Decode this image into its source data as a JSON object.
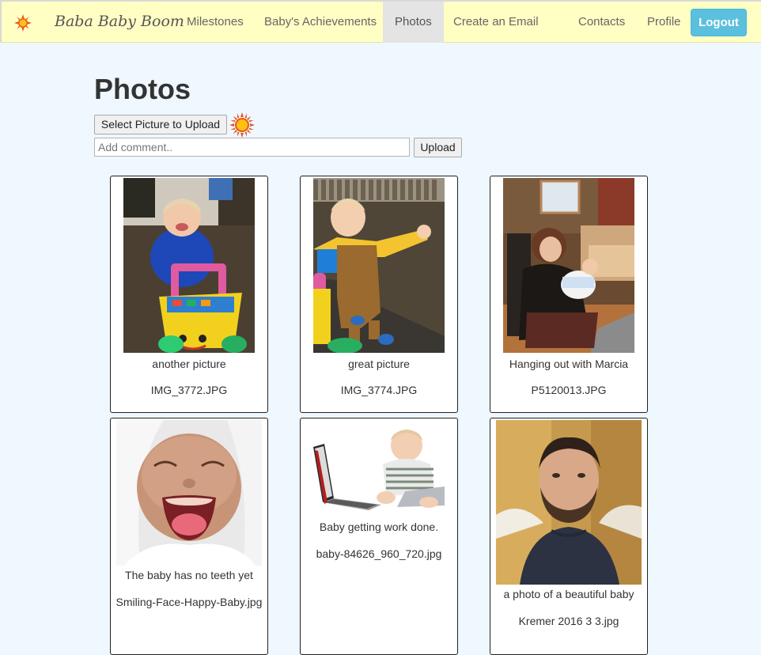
{
  "nav": {
    "brand": "Baba Baby Boom",
    "items": [
      {
        "label": "Milestones",
        "active": false
      },
      {
        "label": "Baby's Achievements",
        "active": false
      },
      {
        "label": "Photos",
        "active": true
      },
      {
        "label": "Create an Email",
        "active": false
      },
      {
        "label": "Contacts",
        "active": false
      },
      {
        "label": "Profile",
        "active": false
      }
    ],
    "logout": "Logout"
  },
  "page": {
    "title": "Photos",
    "select_button": "Select Picture to Upload",
    "comment_placeholder": "Add comment..",
    "upload_button": "Upload"
  },
  "photos": [
    {
      "caption": "another picture",
      "filename": "IMG_3772.JPG"
    },
    {
      "caption": "great picture",
      "filename": "IMG_3774.JPG"
    },
    {
      "caption": "Hanging out with Marcia",
      "filename": "P5120013.JPG"
    },
    {
      "caption": "The baby has no teeth yet",
      "filename": "Smiling-Face-Happy-Baby.jpg"
    },
    {
      "caption": "Baby getting work done.",
      "filename": "baby-84626_960_720.jpg"
    },
    {
      "caption": "a photo of a beautiful baby",
      "filename": "Kremer 2016 3 3.jpg"
    }
  ],
  "colors": {
    "navbar_bg": "#ffffc4",
    "page_bg": "#eff7ff",
    "logout_bg": "#5bc0de",
    "active_tab_bg": "#e4e4e4"
  },
  "icons": {
    "brand": "sun-icon",
    "upload_indicator": "sun-icon"
  }
}
